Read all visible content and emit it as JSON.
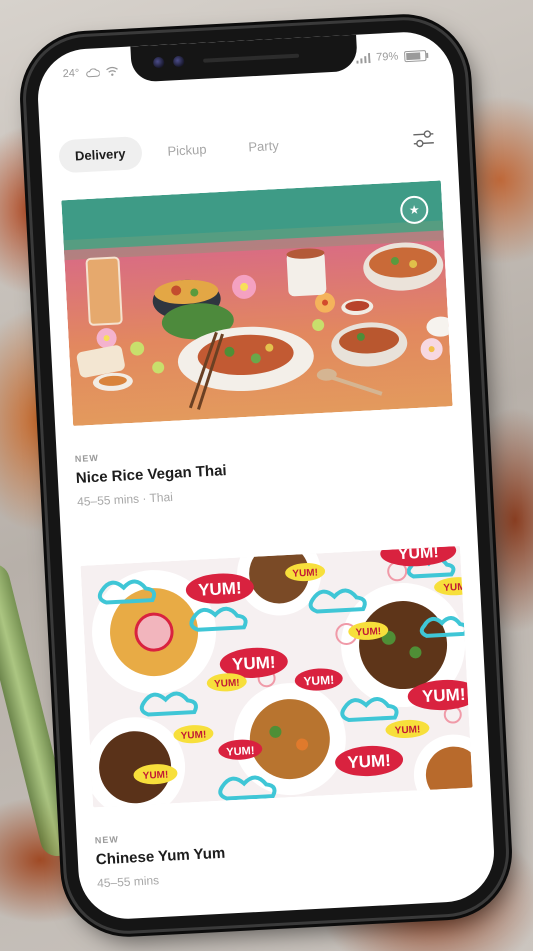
{
  "status": {
    "temperature": "24°",
    "battery": "79%",
    "battery_level": 0.79
  },
  "tabs": [
    {
      "label": "Delivery",
      "active": true
    },
    {
      "label": "Pickup",
      "active": false
    },
    {
      "label": "Party",
      "active": false
    }
  ],
  "restaurants": [
    {
      "tag": "NEW",
      "name": "Nice Rice Vegan Thai",
      "meta": "45–55 mins · Thai",
      "favorite_icon": "star-icon"
    },
    {
      "tag": "NEW",
      "name": "Chinese Yum Yum",
      "meta": "45–55 mins",
      "image_labels": [
        "YUM!",
        "YUM!",
        "YUM!",
        "YUM!",
        "YUM!",
        "YUM!",
        "YUM!",
        "YUM!",
        "YUM!",
        "YUM!",
        "YUM!",
        "YUM!",
        "YUM!",
        "YUM!"
      ]
    }
  ],
  "colors": {
    "accent_red": "#d9223f",
    "yum_yellow": "#f7df3b",
    "cloud_teal": "#3fc6d6"
  }
}
